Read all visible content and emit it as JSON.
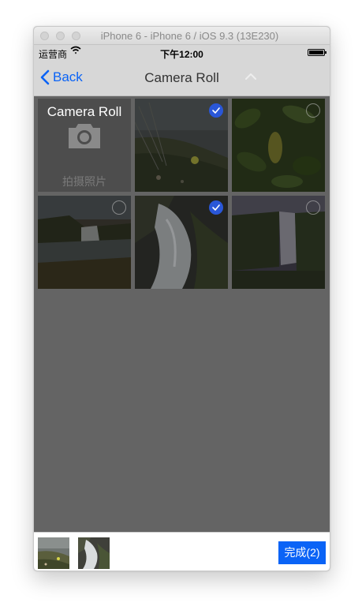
{
  "window": {
    "title": "iPhone 6 - iPhone 6 / iOS 9.3 (13E230)"
  },
  "status_bar": {
    "carrier": "运营商",
    "time": "下午12:00",
    "icons": [
      "wifi-icon",
      "battery-icon"
    ]
  },
  "nav": {
    "back_label": "Back",
    "title": "Camera Roll",
    "accent_color": "#0a63f6"
  },
  "camera_cell": {
    "title": "Camera Roll",
    "label": "拍摄照片",
    "icon": "camera-icon"
  },
  "photos": [
    {
      "name": "photo-meadow-grass",
      "selected": true
    },
    {
      "name": "photo-green-leaves",
      "selected": false
    },
    {
      "name": "photo-waterfall-valley",
      "selected": false
    },
    {
      "name": "photo-waterfall-rocks",
      "selected": true
    },
    {
      "name": "photo-waterfall-mist",
      "selected": false
    }
  ],
  "bottom_bar": {
    "done_label": "完成(2)",
    "selected_thumbs": [
      "photo-meadow-grass",
      "photo-waterfall-rocks"
    ]
  },
  "colors": {
    "check_selected": "#2a57d8",
    "grid_background": "#646464"
  }
}
